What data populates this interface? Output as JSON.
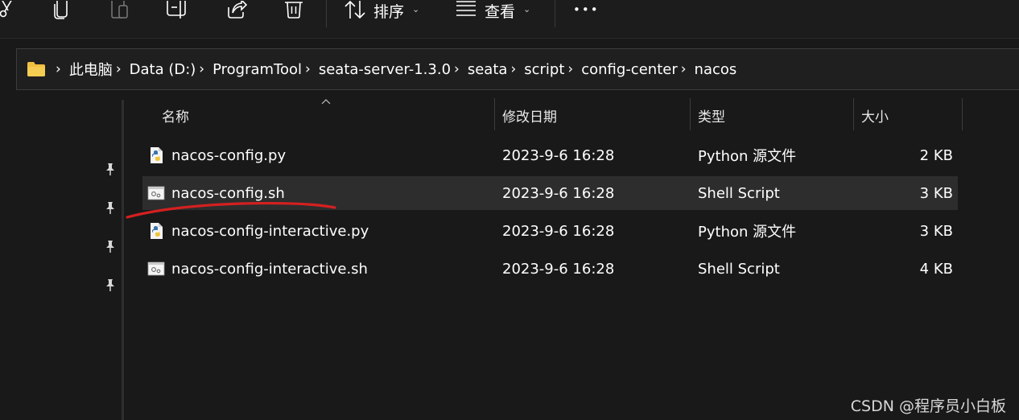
{
  "toolbar": {
    "sort_label": "排序",
    "view_label": "查看",
    "more_label": "•••"
  },
  "addressbar": {
    "crumbs": [
      "此电脑",
      "Data (D:)",
      "ProgramTool",
      "seata-server-1.3.0",
      "seata",
      "script",
      "config-center",
      "nacos"
    ]
  },
  "list": {
    "columns": {
      "name": "名称",
      "modified": "修改日期",
      "type": "类型",
      "size": "大小"
    },
    "rows": [
      {
        "name": "nacos-config.py",
        "modified": "2023-9-6 16:28",
        "type": "Python 源文件",
        "size": "2 KB",
        "icon": "python-file-icon"
      },
      {
        "name": "nacos-config.sh",
        "modified": "2023-9-6 16:28",
        "type": "Shell Script",
        "size": "3 KB",
        "icon": "shell-script-icon"
      },
      {
        "name": "nacos-config-interactive.py",
        "modified": "2023-9-6 16:28",
        "type": "Python 源文件",
        "size": "3 KB",
        "icon": "python-file-icon"
      },
      {
        "name": "nacos-config-interactive.sh",
        "modified": "2023-9-6 16:28",
        "type": "Shell Script",
        "size": "4 KB",
        "icon": "shell-script-icon"
      }
    ],
    "selected_index": 1
  },
  "annotation": {
    "underline_color": "#d42020"
  },
  "watermark": "CSDN @程序员小白板",
  "colors": {
    "background": "#191919",
    "selected_row": "#2d2d2d",
    "folder": "#f1c040"
  }
}
